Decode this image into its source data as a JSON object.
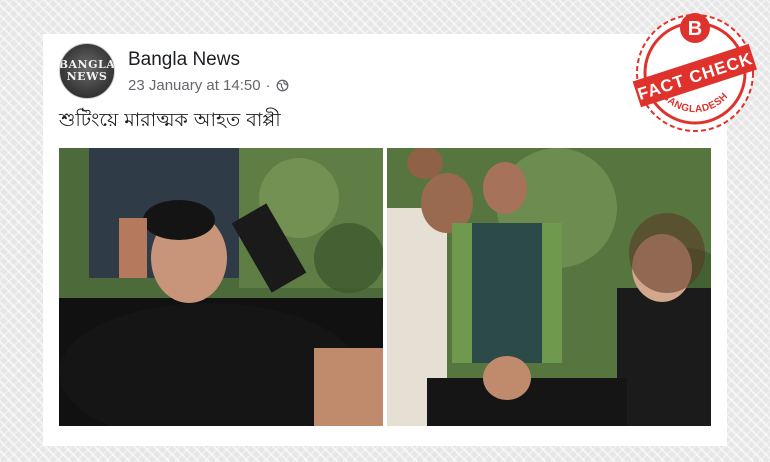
{
  "post": {
    "page_name": "Bangla News",
    "avatar_text_line1": "BANGLA",
    "avatar_text_line2": "NEWS",
    "timestamp": "23 January at 14:50",
    "separator": "·",
    "privacy_icon": "globe-icon",
    "caption": "শুটিংয়ে মারাত্মক আহত বাপ্পী"
  },
  "badge": {
    "letter": "B",
    "top_text": "FACT CHECK",
    "bottom_text": "BANGLADESH",
    "color": "#e0322d"
  },
  "photos": [
    {
      "name": "photo-left",
      "description_icon": "photo-icon"
    },
    {
      "name": "photo-right",
      "description_icon": "photo-icon"
    }
  ],
  "colors": {
    "page_bg": "#e6e6e6",
    "card_bg": "#ffffff",
    "name_text": "#1c1e21",
    "meta_text": "#65676b"
  }
}
